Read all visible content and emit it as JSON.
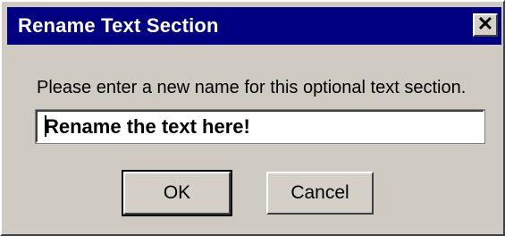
{
  "window": {
    "title": "Rename Text Section",
    "close_label": "✕"
  },
  "dialog": {
    "prompt": "Please enter a new name for this optional text section.",
    "input_value": "Rename the text here!"
  },
  "buttons": {
    "ok_label": "OK",
    "cancel_label": "Cancel"
  },
  "colors": {
    "titlebar": "#000080",
    "dialog_bg": "#cfcbc3"
  }
}
